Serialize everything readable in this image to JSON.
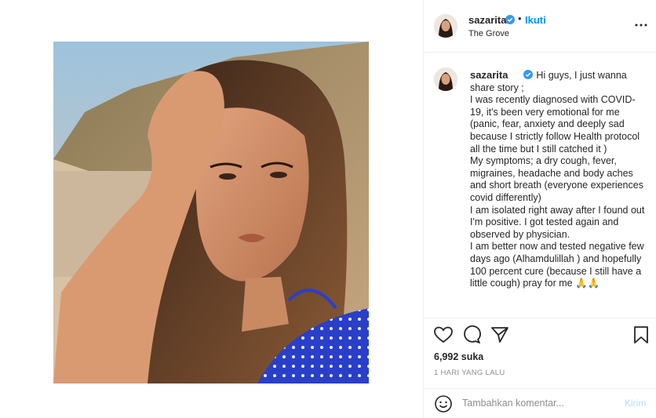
{
  "post": {
    "image_alt": "selfie photo"
  },
  "header": {
    "username": "sazarita",
    "dot": "•",
    "follow_label": "Ikuti",
    "location": "The Grove",
    "avatar_icon": "profile-avatar",
    "verified_icon": "verified-badge-icon",
    "more_icon": "more-options-icon"
  },
  "caption": {
    "username": "sazarita",
    "text": "Hi guys, I just wanna share story ;\nI was recently diagnosed with COVID-19, it's been very emotional for me (panic, fear, anxiety and deeply sad because I strictly follow Health protocol all the time but I still catched it )\nMy symptoms; a dry cough, fever, migraines, headache and body aches and short breath (everyone experiences covid differently)\nI am isolated right away after I found out I'm positive. I got tested again and observed by physician.\nI am better now and tested negative few days ago (Alhamdulillah ) and hopefully 100 percent cure (because I still have a little cough) pray for me 🙏🙏"
  },
  "actions": {
    "like_icon": "heart-icon",
    "comment_icon": "comment-icon",
    "share_icon": "share-icon",
    "save_icon": "bookmark-icon"
  },
  "likes": "6,992 suka",
  "timestamp": "1 HARI YANG LALU",
  "comment": {
    "placeholder": "Tambahkan komentar...",
    "post_label": "Kirim",
    "emoji_icon": "emoji-icon"
  },
  "colors": {
    "accent": "#0095f6",
    "verified": "#3897f0",
    "post_disabled": "#b2dffc",
    "text": "#262626",
    "muted": "#8e8e8e"
  }
}
